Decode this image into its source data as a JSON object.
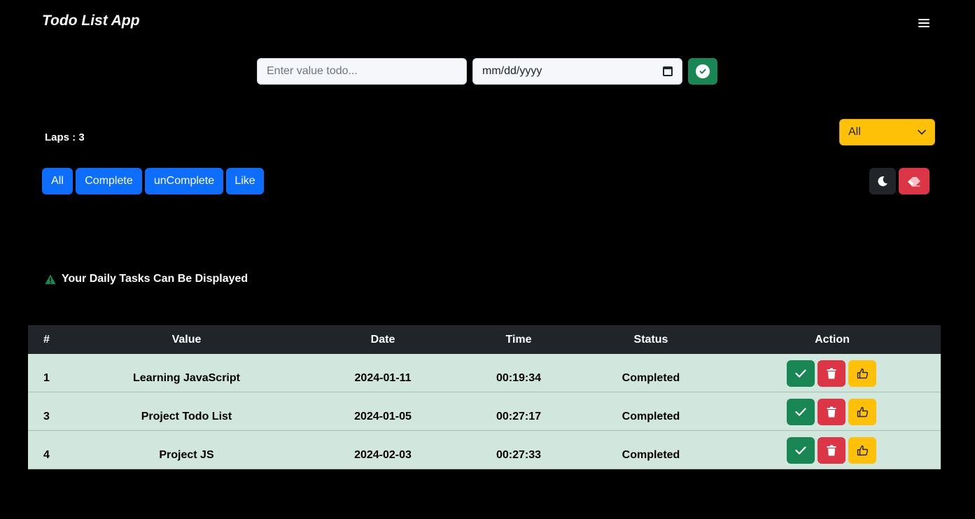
{
  "navbar": {
    "brand": "Todo List App",
    "menu_icon": "hamburger-icon"
  },
  "form": {
    "todo_placeholder": "Enter value todo...",
    "date_placeholder": "mm/dd/yyyy",
    "add_icon": "check-circle-icon"
  },
  "laps": "Laps : 3",
  "filter_select": {
    "selected": "All"
  },
  "tabs": [
    {
      "label": "All"
    },
    {
      "label": "Complete"
    },
    {
      "label": "unComplete"
    },
    {
      "label": "Like"
    }
  ],
  "controls": {
    "dark_mode_icon": "moon-icon",
    "clear_icon": "eraser-icon"
  },
  "alert": {
    "text": "Your Daily Tasks Can Be Displayed",
    "icon": "warning-triangle-icon"
  },
  "table": {
    "headers": {
      "num": "#",
      "value": "Value",
      "date": "Date",
      "time": "Time",
      "status": "Status",
      "action": "Action"
    },
    "rows": [
      {
        "num": "1",
        "value": "Learning JavaScript",
        "date": "2024-01-11",
        "time": "00:19:34",
        "status": "Completed"
      },
      {
        "num": "3",
        "value": "Project Todo List",
        "date": "2024-01-05",
        "time": "00:27:17",
        "status": "Completed"
      },
      {
        "num": "4",
        "value": "Project JS",
        "date": "2024-02-03",
        "time": "00:27:33",
        "status": "Completed"
      }
    ]
  },
  "colors": {
    "background": "#000000",
    "primary": "#0d6efd",
    "success": "#198754",
    "danger": "#dc3545",
    "warning": "#ffc107",
    "row_bg": "#d1e7dd",
    "header_bg": "#212529"
  }
}
